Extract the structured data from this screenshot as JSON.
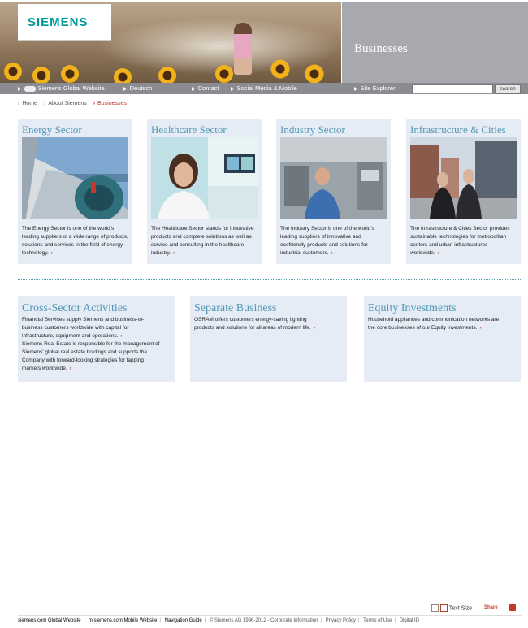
{
  "brand": {
    "logo": "SIEMENS"
  },
  "header": {
    "section_title": "Businesses"
  },
  "nav": {
    "items": [
      "Siemens Global Website",
      "Deutsch",
      "Contact",
      "Social Media & Mobile",
      "Site Explorer"
    ],
    "search_value": "",
    "search_button": "search"
  },
  "breadcrumb": [
    "Home",
    "About Siemens",
    "Businesses"
  ],
  "sectors": [
    {
      "title": "Energy Sector",
      "text": "The Energy Sector is one of the world's leading suppliers of a wide range of products, solutions and services in the field of energy technology."
    },
    {
      "title": "Healthcare Sector",
      "text": "The Healthcare Sector stands for innovative products and complete solutions as well as service and consulting in the healthcare industry."
    },
    {
      "title": "Industry Sector",
      "text": "The Industry Sector is one of the world's leading suppliers of innovative and ecofriendly products and solutions for industrial customers."
    },
    {
      "title": "Infrastructure & Cities",
      "text": "The Infrastructure & Cities Sector provides sustainable technologies for metropolitan centers and urban infrastructures worldwide."
    }
  ],
  "other": [
    {
      "title": "Cross-Sector Activities",
      "lines": [
        "Financial Services supply Siemens and business-to-",
        "business customers worldwide with capital for",
        "infrastructure, equipment and operations."
      ],
      "lines2": [
        "Siemens Real Estate is responsible for the management of",
        "Siemens' global real estate holdings and supports the",
        "Company with forward-looking strategies for tapping",
        "markets worldwide."
      ]
    },
    {
      "title": "Separate Business",
      "lines": [
        "OSRAM offers customers energy-saving lighting",
        "products and solutions for all areas of modern life."
      ]
    },
    {
      "title": "Equity Investments",
      "lines": [
        "Household appliances and communication networks are",
        "the core businesses of our Equity investments."
      ]
    }
  ],
  "tools": {
    "text_size": "Text Size",
    "share": "Share"
  },
  "footer": {
    "links": [
      "siemens.com Global Website",
      "m.siemens.com Mobile Website",
      "Navigation Guide",
      "© Siemens AG 1996-2012 - Corporate Information",
      "Privacy Policy",
      "Terms of Use",
      "Digital ID"
    ]
  },
  "colors": {
    "accent_teal": "#009999",
    "title_blue": "#5497b5",
    "card_bg": "#e5ecf6",
    "arrow_red": "#c0392b"
  }
}
